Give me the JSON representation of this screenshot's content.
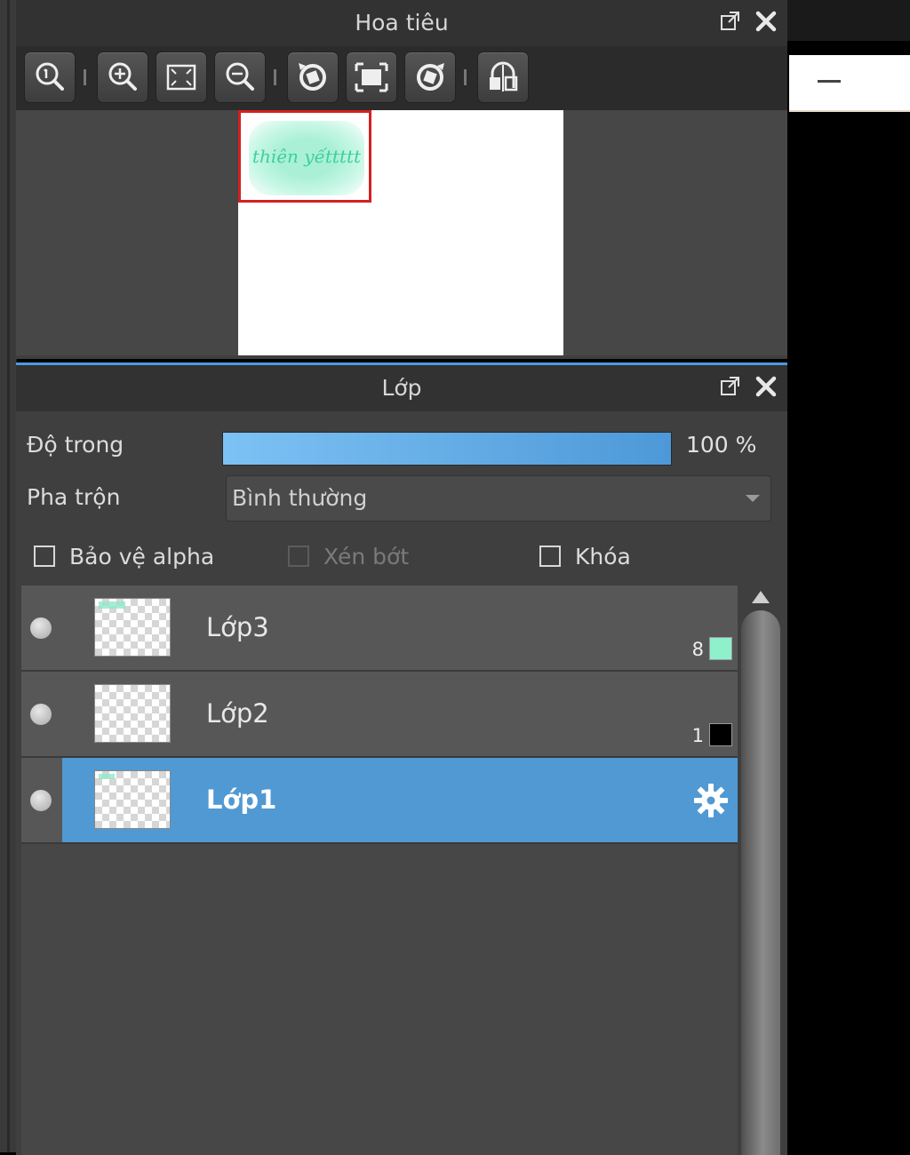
{
  "navigator": {
    "title": "Hoa tiêu",
    "toolbar": [
      "zoom-actual-icon",
      "zoom-in-icon",
      "fit-screen-icon",
      "zoom-out-icon",
      "rotate-left-icon",
      "fit-canvas-icon",
      "rotate-right-icon",
      "flip-horizontal-icon"
    ],
    "preview_text": "thiên yếttttt"
  },
  "layers_panel": {
    "title": "Lớp",
    "opacity_label": "Độ trong",
    "opacity_value": "100 %",
    "opacity_fraction": 1.0,
    "blend_label": "Pha trộn",
    "blend_value": "Bình thường",
    "protect_alpha_label": "Bảo vệ alpha",
    "clipping_label": "Xén bớt",
    "lock_label": "Khóa",
    "layers": [
      {
        "name": "Lớp3",
        "count": "8",
        "swatch": "#8ff0cc",
        "selected": false
      },
      {
        "name": "Lớp2",
        "count": "1",
        "swatch": "#000000",
        "selected": false
      },
      {
        "name": "Lớp1",
        "count": "",
        "swatch": "",
        "selected": true
      }
    ]
  },
  "colors": {
    "accent": "#5199d3",
    "panel_bg": "#3f3f3f",
    "header_bg": "#323232",
    "nav_frame": "#d42020"
  }
}
